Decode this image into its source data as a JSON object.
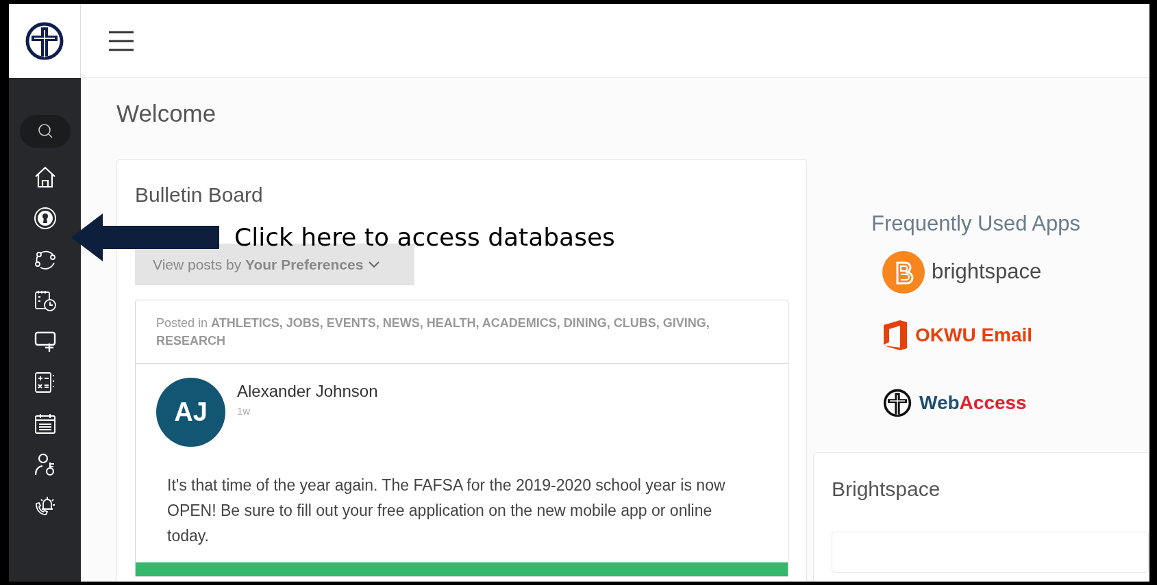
{
  "page_title": "Welcome",
  "annotation": {
    "text": "Click here to access databases"
  },
  "bulletin_board": {
    "title": "Bulletin Board",
    "filter": "View posts by **Your Preferences**",
    "post": {
      "posted_in": "Posted in **ATHLETICS, JOBS, EVENTS, NEWS, HEALTH, ACADEMICS, DINING, CLUBS, GIVING, RESEARCH**",
      "author": "Alexander Johnson",
      "initials": "AJ",
      "time": "1w",
      "body": "It's that time of the year again. The FAFSA for the 2019-2020 school year is now OPEN! Be sure to fill out your free application on the new mobile app or online today."
    }
  },
  "frequently_used_apps": {
    "title": "Frequently Used Apps",
    "apps": [
      {
        "kind": "brightspace",
        "parts": [
          "brightspace"
        ]
      },
      {
        "kind": "email",
        "parts": [
          "OKWU Email"
        ]
      },
      {
        "kind": "webaccess",
        "parts": [
          "Web",
          "Access"
        ]
      }
    ]
  },
  "brightspace_panel": {
    "title": "Brightspace"
  }
}
